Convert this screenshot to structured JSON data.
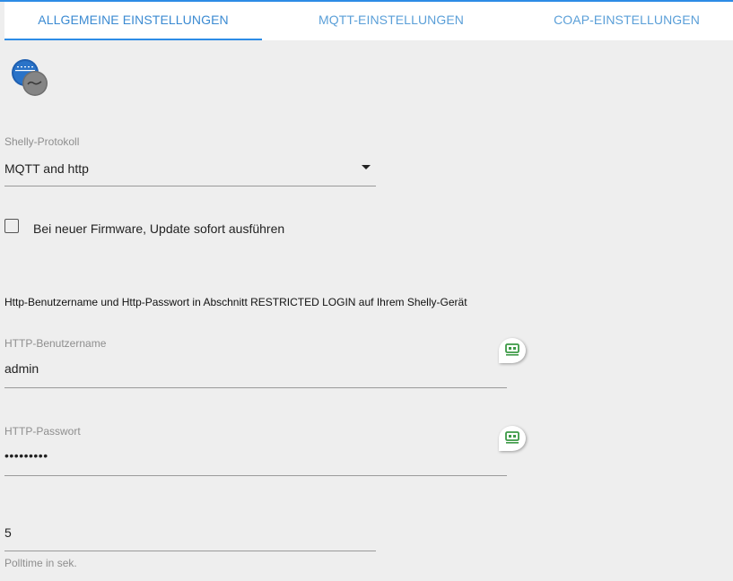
{
  "tabs": [
    {
      "label": "ALLGEMEINE EINSTELLUNGEN"
    },
    {
      "label": "MQTT-EINSTELLUNGEN"
    },
    {
      "label": "COAP-EINSTELLUNGEN"
    }
  ],
  "colors": {
    "accent": "#2d8ce6",
    "key_icon": "#3c9a46"
  },
  "protocol": {
    "label": "Shelly-Protokoll",
    "value": "MQTT and http"
  },
  "firmware": {
    "label": "Bei neuer Firmware, Update sofort ausführen",
    "checked": false
  },
  "info_text": "Http-Benutzername und Http-Passwort in Abschnitt RESTRICTED LOGIN auf Ihrem Shelly-Gerät",
  "http_user": {
    "label": "HTTP-Benutzername",
    "value": "admin"
  },
  "http_password": {
    "label": "HTTP-Passwort",
    "value": "•••••••••"
  },
  "polltime": {
    "value": "5",
    "helper": "Polltime in sek."
  },
  "icons": {
    "logo": "shelly-logo-icon",
    "key": "key-icon",
    "dropdown": "dropdown-arrow-icon"
  }
}
